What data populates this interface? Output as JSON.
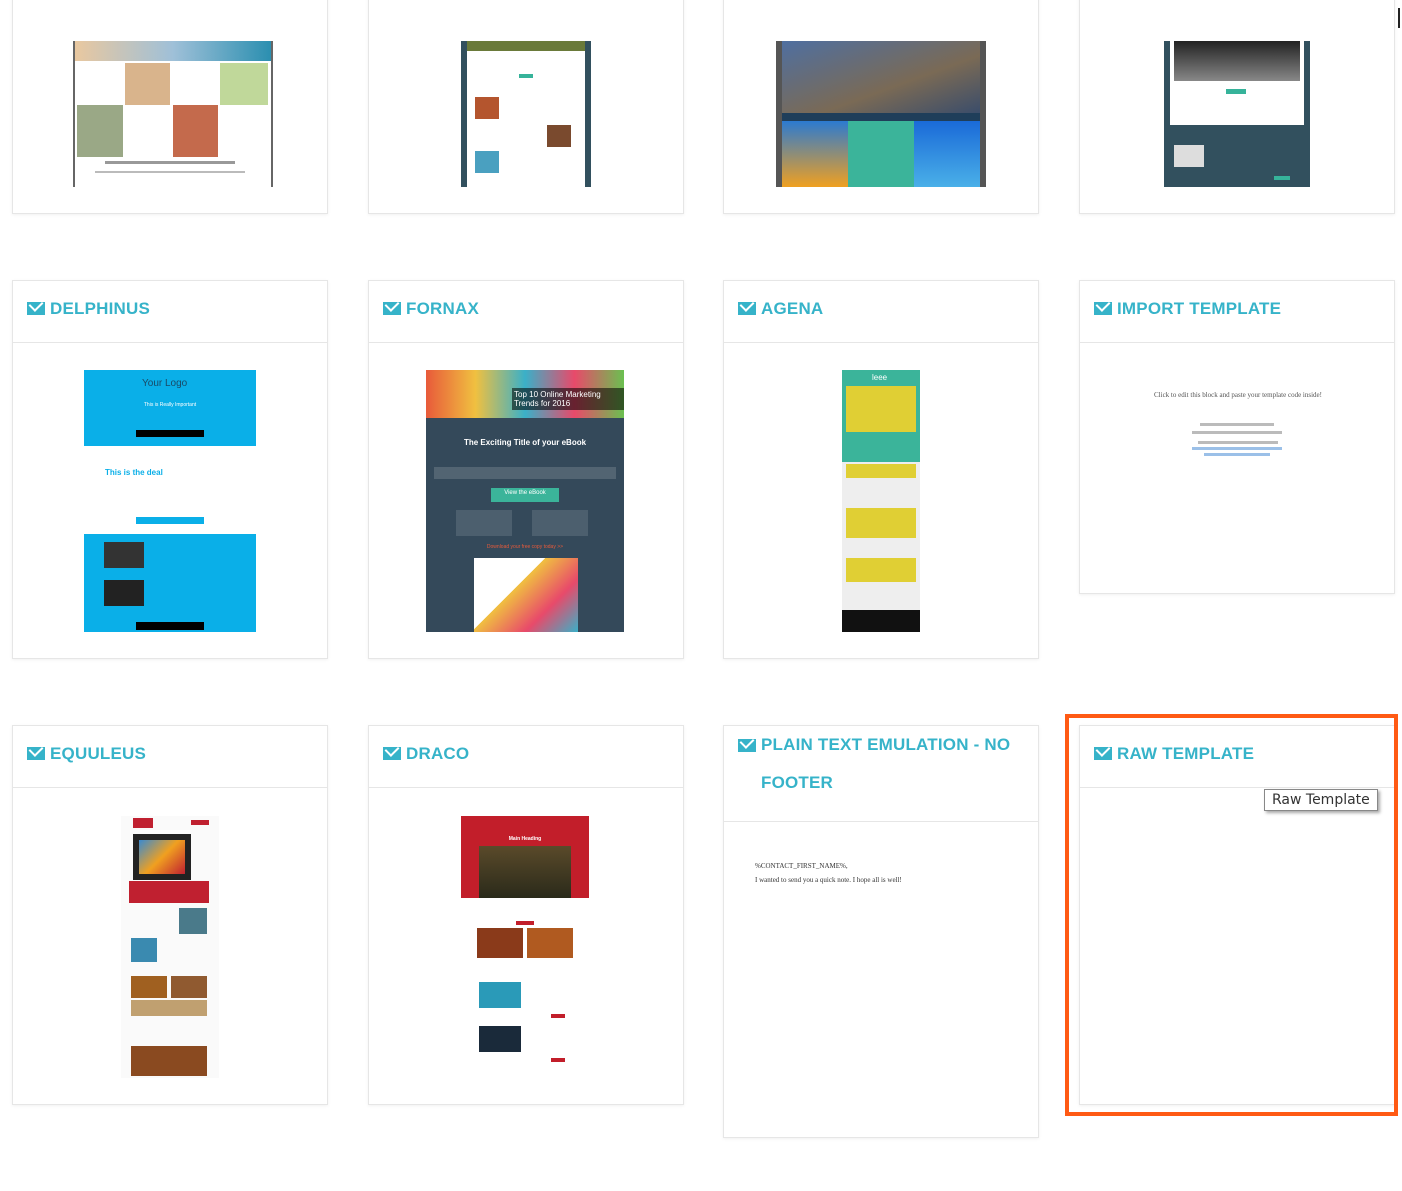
{
  "templates": [
    {
      "name": "DELPHINUS",
      "preview": {
        "logo": "Your Logo",
        "subtitle": "This is Really Important",
        "heading": "This is the deal"
      }
    },
    {
      "name": "FORNAX",
      "preview": {
        "banner": "Top 10 Online Marketing Trends for 2016",
        "title": "The Exciting Title of your eBook",
        "button": "View the eBook",
        "footer": "Download your free copy today >>"
      }
    },
    {
      "name": "AGENA",
      "preview": {
        "logo": "leee"
      }
    },
    {
      "name": "IMPORT TEMPLATE",
      "preview": {
        "text": "Click to edit this block and paste your template code inside!"
      }
    },
    {
      "name": "EQUULEUS",
      "preview": {}
    },
    {
      "name": "DRACO",
      "preview": {
        "heading": "Main Heading"
      }
    },
    {
      "name": "PLAIN TEXT EMULATION - NO FOOTER",
      "preview": {
        "line1": "%CONTACT_FIRST_NAME%,",
        "line2": "I wanted to send you a quick note. I hope all is well!"
      }
    },
    {
      "name": "RAW TEMPLATE",
      "preview": {}
    }
  ],
  "tooltip": "Raw Template",
  "colors": {
    "accent": "#36b3c9",
    "highlight": "#ff5a14"
  }
}
